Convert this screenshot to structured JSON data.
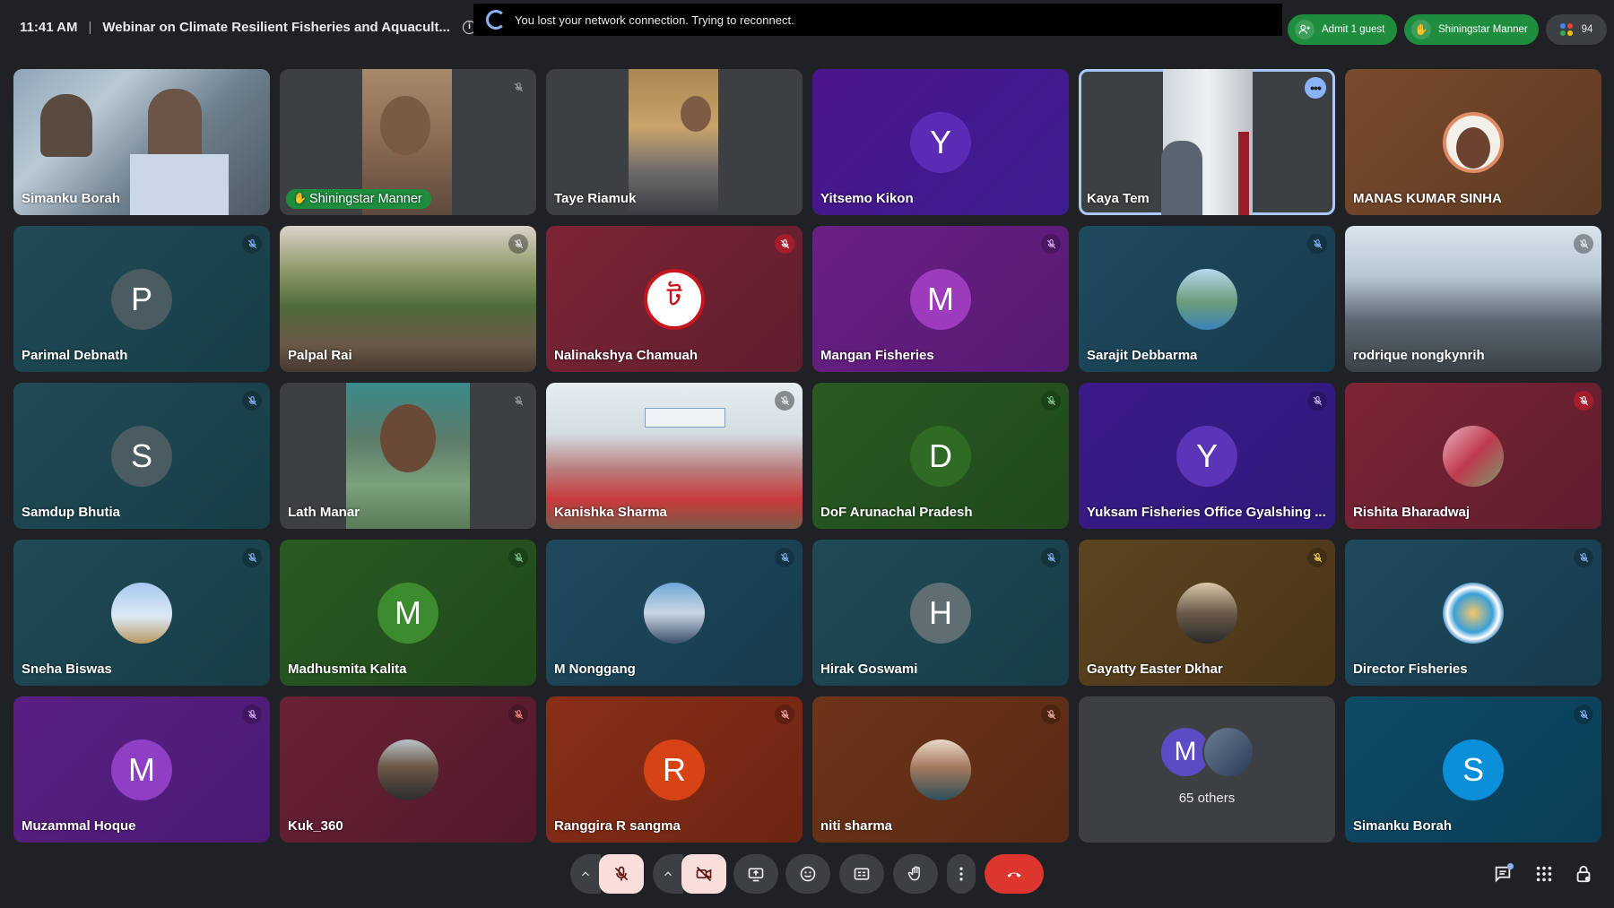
{
  "meeting": {
    "time": "11:41 AM",
    "title": "Webinar on Climate Resilient Fisheries and Aquacult...",
    "banner_text": "You lost your network connection. Trying to reconnect.",
    "admit_label": "Admit 1 guest",
    "hand_label": "Shiningstar Manner",
    "participant_count": "94"
  },
  "tiles": [
    {
      "name": "Simanku Borah",
      "type": "video"
    },
    {
      "name": "Shiningstar Manner",
      "type": "video",
      "hand_raised": true
    },
    {
      "name": "Taye Riamuk",
      "type": "video"
    },
    {
      "name": "Yitsemo Kikon",
      "type": "letter",
      "initial": "Y"
    },
    {
      "name": "Kaya Tem",
      "type": "video",
      "active_speaker": true
    },
    {
      "name": "MANAS KUMAR SINHA",
      "type": "photo"
    },
    {
      "name": "Parimal Debnath",
      "type": "letter",
      "initial": "P",
      "muted": true
    },
    {
      "name": "Palpal Rai",
      "type": "video",
      "muted": true
    },
    {
      "name": "Nalinakshya Chamuah",
      "type": "photo",
      "muted": true
    },
    {
      "name": "Mangan Fisheries",
      "type": "letter",
      "initial": "M",
      "muted": true
    },
    {
      "name": "Sarajit Debbarma",
      "type": "photo",
      "muted": true
    },
    {
      "name": "rodrique nongkynrih",
      "type": "video",
      "muted": true
    },
    {
      "name": "Samdup Bhutia",
      "type": "letter",
      "initial": "S",
      "muted": true
    },
    {
      "name": "Lath Manar",
      "type": "video",
      "muted": true
    },
    {
      "name": "Kanishka Sharma",
      "type": "video",
      "muted": true
    },
    {
      "name": "DoF Arunachal Pradesh",
      "type": "letter",
      "initial": "D",
      "muted": true
    },
    {
      "name": "Yuksam Fisheries Office Gyalshing ...",
      "type": "letter",
      "initial": "Y",
      "muted": true
    },
    {
      "name": "Rishita Bharadwaj",
      "type": "photo",
      "muted": true
    },
    {
      "name": "Sneha Biswas",
      "type": "photo",
      "muted": true
    },
    {
      "name": "Madhusmita Kalita",
      "type": "letter",
      "initial": "M",
      "muted": true
    },
    {
      "name": "M Nonggang",
      "type": "photo",
      "muted": true
    },
    {
      "name": "Hirak Goswami",
      "type": "letter",
      "initial": "H",
      "muted": true
    },
    {
      "name": "Gayatty Easter Dkhar",
      "type": "photo",
      "muted": true
    },
    {
      "name": "Director Fisheries",
      "type": "photo",
      "muted": true
    },
    {
      "name": "Muzammal Hoque",
      "type": "letter",
      "initial": "M",
      "muted": true
    },
    {
      "name": "Kuk_360",
      "type": "photo",
      "muted": true
    },
    {
      "name": "Ranggira R sangma",
      "type": "letter",
      "initial": "R",
      "muted": true
    },
    {
      "name": "niti sharma",
      "type": "photo",
      "muted": true
    },
    {
      "name": "65 others",
      "type": "others",
      "initial": "M"
    },
    {
      "name": "Simanku Borah",
      "type": "letter",
      "initial": "S",
      "muted": true
    }
  ],
  "controls": [
    {
      "id": "mic",
      "icon": "mic-off-icon"
    },
    {
      "id": "camera",
      "icon": "camera-off-icon"
    },
    {
      "id": "present",
      "icon": "present-screen-icon"
    },
    {
      "id": "reactions",
      "icon": "emoji-icon"
    },
    {
      "id": "captions",
      "icon": "captions-icon"
    },
    {
      "id": "raise-hand",
      "icon": "hand-icon"
    },
    {
      "id": "more",
      "icon": "more-vert-icon"
    },
    {
      "id": "leave",
      "icon": "end-call-icon"
    }
  ]
}
